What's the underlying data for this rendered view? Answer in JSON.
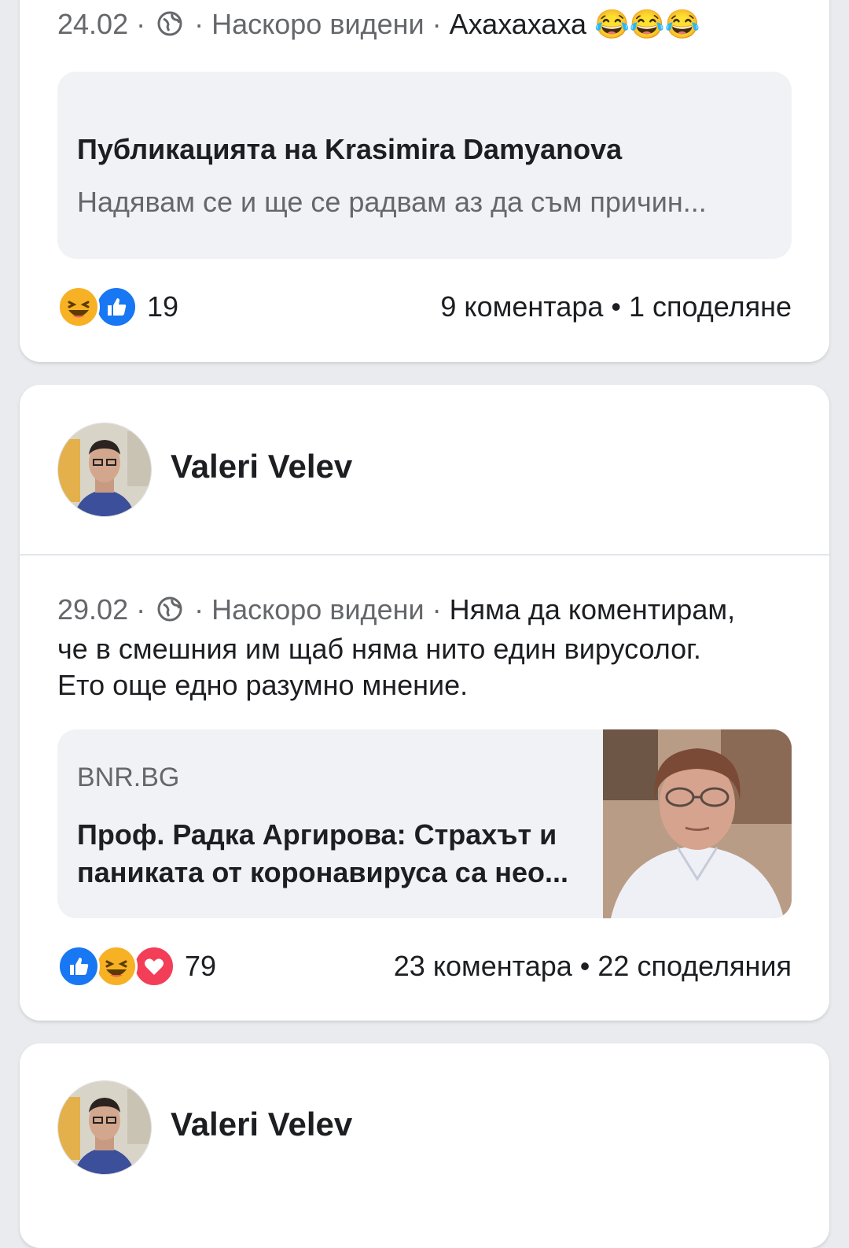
{
  "post1": {
    "date": "24.02",
    "sep1": " · ",
    "visibility": " · Наскоро видени · ",
    "text": "Ахахахаха 😂😂😂",
    "shared_title": "Публикацията на Krasimira Damyanova",
    "shared_text": "Надявам се и ще се радвам аз да съм причин...",
    "reaction_count": "19",
    "counts": "9 коментара • 1 споделяне",
    "reactions": [
      "haha-icon",
      "like-icon"
    ]
  },
  "post2": {
    "author": "Valeri Velev",
    "date": "29.02",
    "sep1": " · ",
    "visibility": " · Наскоро видени · ",
    "text_line1": "Няма да коментирам,",
    "text_line2": "че в смешния им щаб няма нито един вирусолог.",
    "text_line3": "Ето още едно разумно мнение.",
    "link_domain": "BNR.BG",
    "link_title_line1": "Проф. Радка Аргирова: Страхът и",
    "link_title_line2": "паниката от коронавируса са нео...",
    "reaction_count": "79",
    "counts": "23 коментара • 22 споделяния",
    "reactions": [
      "like-icon",
      "haha-icon",
      "love-icon"
    ]
  },
  "post3": {
    "author": "Valeri Velev"
  },
  "colors": {
    "background": "#e9ebee",
    "like_blue": "#1877f2",
    "love_red": "#f33e58",
    "haha_yellow": "#f7b125",
    "muted_text": "#65676b"
  }
}
